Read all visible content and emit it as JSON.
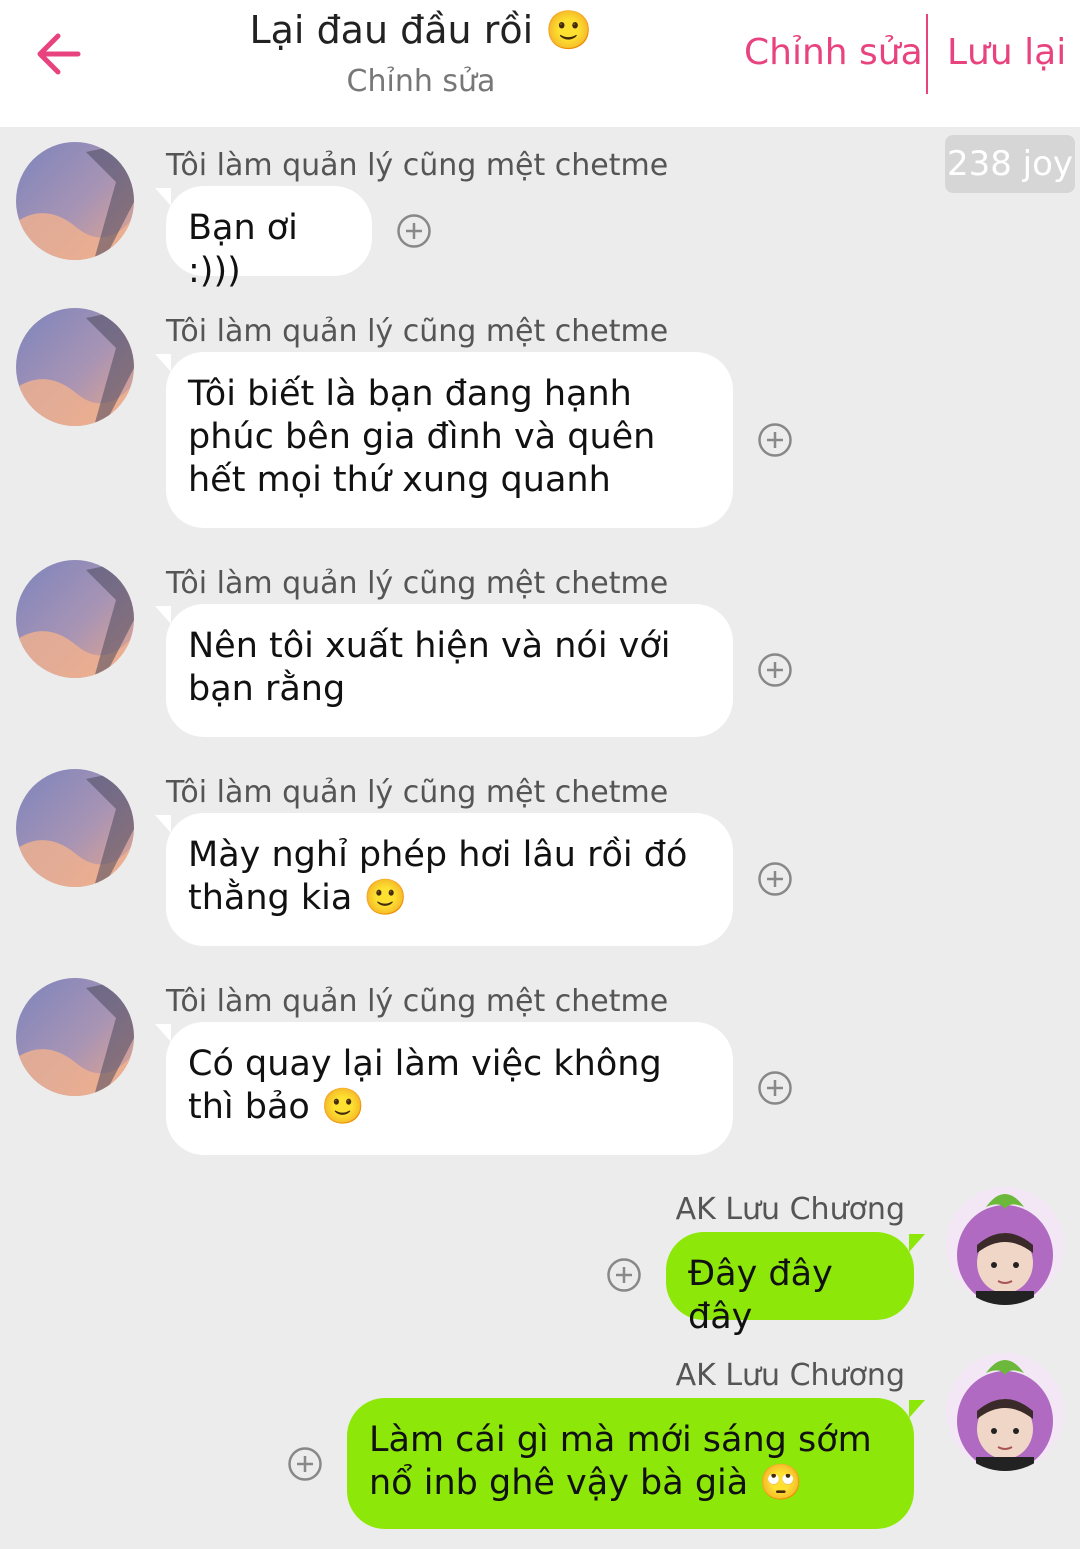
{
  "header": {
    "title": "Lại đau đầu rồi 🙂",
    "subtitle": "Chỉnh sửa",
    "edit_label": "Chỉnh sửa",
    "save_label": "Lưu lại"
  },
  "badge": {
    "text": "238 joy"
  },
  "colors": {
    "accent": "#e8437f",
    "incoming_bubble": "#ffffff",
    "outgoing_bubble": "#8de80a",
    "background": "#ececec"
  },
  "icons": {
    "back": "arrow-left-icon",
    "add": "plus-circle-icon",
    "smiley": "slightly-smiling-face-emoji",
    "eye_roll": "face-with-rolling-eyes-emoji"
  },
  "messages": [
    {
      "sender": "Tôi làm quản lý cũng mệt chetme",
      "text": "Bạn ơi :)))",
      "side": "left"
    },
    {
      "sender": "Tôi làm quản lý cũng mệt chetme",
      "text": "Tôi biết là bạn đang hạnh phúc bên gia đình và quên hết mọi thứ xung quanh",
      "side": "left"
    },
    {
      "sender": "Tôi làm quản lý cũng mệt chetme",
      "text": "Nên tôi xuất hiện và nói với bạn rằng",
      "side": "left"
    },
    {
      "sender": "Tôi làm quản lý cũng mệt chetme",
      "text": "Mày nghỉ phép hơi lâu rồi đó thằng kia 🙂",
      "side": "left"
    },
    {
      "sender": "Tôi làm quản lý cũng mệt chetme",
      "text": "Có quay lại làm việc không thì bảo 🙂",
      "side": "left"
    },
    {
      "sender": "AK Lưu Chương",
      "text": "Đây đây đây",
      "side": "right"
    },
    {
      "sender": "AK Lưu Chương",
      "text": "Làm cái gì mà mới sáng sớm nổ inb ghê vậy bà già 🙄",
      "side": "right"
    }
  ]
}
